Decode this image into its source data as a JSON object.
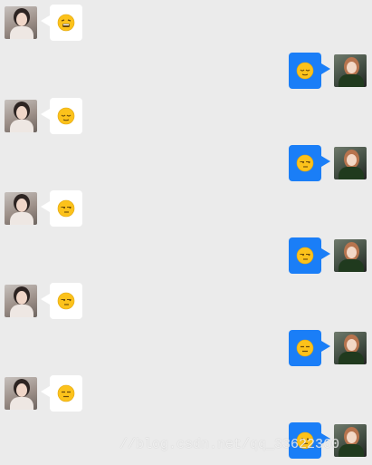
{
  "messages": [
    {
      "side": "left",
      "emoji": "weary-face-emoji"
    },
    {
      "side": "right",
      "emoji": "relieved-face-emoji"
    },
    {
      "side": "left",
      "emoji": "relieved-face-emoji"
    },
    {
      "side": "right",
      "emoji": "unamused-face-emoji"
    },
    {
      "side": "left",
      "emoji": "unamused-face-emoji"
    },
    {
      "side": "right",
      "emoji": "unamused-face-emoji"
    },
    {
      "side": "left",
      "emoji": "unamused-face-emoji"
    },
    {
      "side": "right",
      "emoji": "expressionless-face-emoji"
    },
    {
      "side": "left",
      "emoji": "expressionless-face-emoji"
    },
    {
      "side": "right",
      "emoji": "confused-face-emoji"
    }
  ],
  "colors": {
    "background": "#ebebeb",
    "incoming_bubble": "#ffffff",
    "outgoing_bubble": "#1a7ef7",
    "emoji_fill": "#fcc21b"
  },
  "watermark": "//blog.csdn.net/qq_33622360"
}
